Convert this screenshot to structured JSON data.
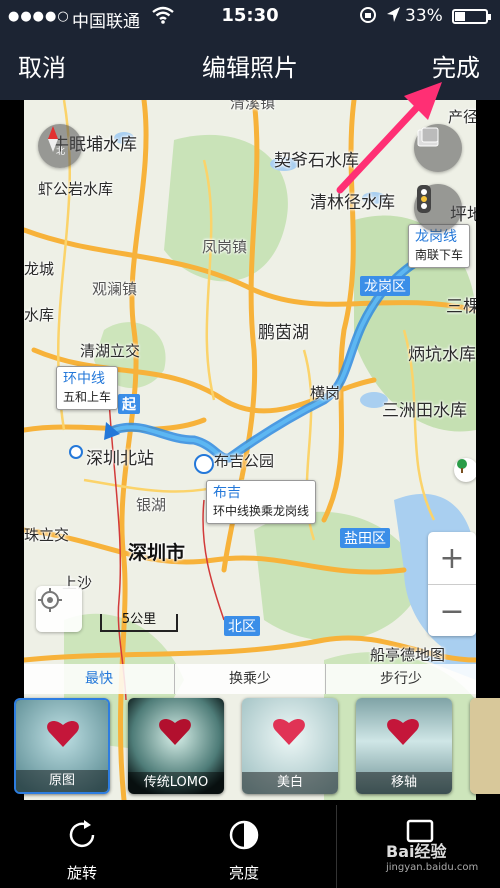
{
  "status": {
    "signal": "●●●●○",
    "carrier": "中国联通",
    "time": "15:30",
    "battery": "33%",
    "battery_level": 0.33
  },
  "nav": {
    "cancel": "取消",
    "title": "编辑照片",
    "done": "完成"
  },
  "map": {
    "labels": {
      "l0": "清溪镇",
      "l1": "产径",
      "l2": "牛眠埔水库",
      "l3": "契爷石水库",
      "l4": "虾公岩水库",
      "l5": "清林径水库",
      "l6": "坪地",
      "l7": "凤岗镇",
      "l8": "观澜镇",
      "l9": "龙城",
      "l10": "水库",
      "l11": "鹏茵湖",
      "l12": "三棵",
      "l13": "清湖立交",
      "l14": "炳坑水库",
      "l15": "横岗",
      "l16": "三洲田水库",
      "l17": "深圳北站",
      "l18": "布吉公园",
      "l19": "银湖",
      "l20": "珠立交",
      "l21": "深圳市",
      "l22": "上沙",
      "l23": "盐田区",
      "l24": "北区",
      "l25": "船亭德地图",
      "l26": "龙岗区"
    },
    "start_marker": "起",
    "tip_start": {
      "line": "环中线",
      "desc": "五和上车"
    },
    "tip_end": {
      "line": "龙岗线",
      "desc": "南联下车"
    },
    "tip_transfer": {
      "line": "布吉",
      "desc": "环中线换乘龙岗线"
    },
    "scale": "5公里",
    "compass": "北",
    "zoom_in": "+",
    "zoom_out": "−"
  },
  "route_tabs": [
    "最快",
    "换乘少",
    "步行少"
  ],
  "filters": [
    "原图",
    "传统LOMO",
    "美白",
    "移轴"
  ],
  "tools": {
    "rotate": "旋转",
    "brightness": "亮度"
  },
  "watermark": {
    "brand": "Bai经验",
    "url": "jingyan.baidu.com"
  },
  "colors": {
    "bar": "#1c2433",
    "accent": "#2478d9",
    "route": "#3aa0e8",
    "arrow": "#ff2f74"
  }
}
